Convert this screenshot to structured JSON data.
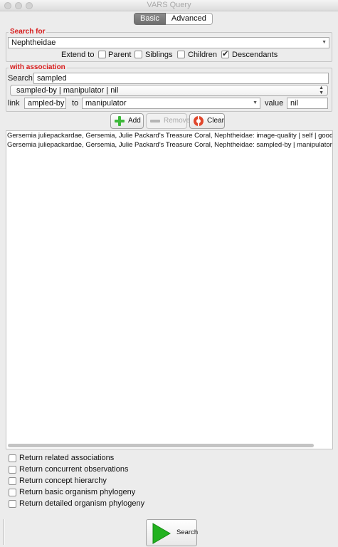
{
  "window": {
    "title": "VARS Query"
  },
  "tabs": [
    {
      "label": "Basic",
      "active": true
    },
    {
      "label": "Advanced",
      "active": false
    }
  ],
  "search_for": {
    "title": "Search for",
    "concept_value": "Nephtheidae",
    "extend_label": "Extend to",
    "options": [
      {
        "label": "Parent",
        "checked": false
      },
      {
        "label": "Siblings",
        "checked": false
      },
      {
        "label": "Children",
        "checked": false
      },
      {
        "label": "Descendants",
        "checked": true
      }
    ]
  },
  "association": {
    "title": "with association",
    "search_label": "Search:",
    "search_value": "sampled",
    "selected_association": "sampled-by | manipulator | nil",
    "link_label": "link",
    "link_value": "ampled-by",
    "to_label": "to",
    "to_value": "manipulator",
    "value_label": "value",
    "value_value": "nil"
  },
  "actions": {
    "add_label": "Add",
    "remove_label": "Remove",
    "clear_label": "Clear"
  },
  "results": [
    "Gersemia juliepackardae, Gersemia, Julie Packard's Treasure Coral, Nephtheidae: image-quality | self | good",
    "Gersemia juliepackardae, Gersemia, Julie Packard's Treasure Coral, Nephtheidae: sampled-by | manipulator | nil"
  ],
  "return_options": [
    {
      "label": "Return related associations",
      "checked": false
    },
    {
      "label": "Return concurrent observations",
      "checked": false
    },
    {
      "label": "Return concept hierarchy",
      "checked": false
    },
    {
      "label": "Return basic organism phylogeny",
      "checked": false
    },
    {
      "label": "Return detailed organism phylogeny",
      "checked": false
    }
  ],
  "search_button": {
    "label": "Search"
  },
  "colors": {
    "group_title": "#d71b1b",
    "add_icon": "#3db83a",
    "clear_icon": "#e0472c",
    "search_icon": "#22b21f"
  }
}
